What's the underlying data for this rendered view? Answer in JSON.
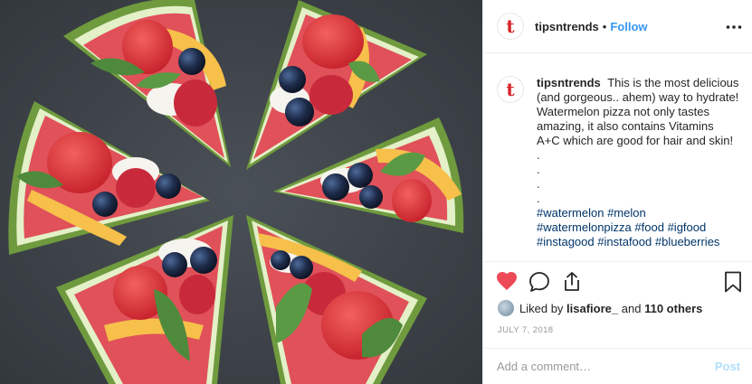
{
  "post": {
    "avatar_letter": "t",
    "username": "tipsntrends",
    "separator": "•",
    "follow_label": "Follow",
    "more_label": "•••"
  },
  "caption": {
    "username": "tipsntrends",
    "text": "This is the most delicious (and gorgeous.. ahem) way to hydrate! Watermelon pizza not only tastes amazing, it also contains Vitamins A+C which are good for hair and skin!",
    "dots": [
      ".",
      ".",
      ".",
      "."
    ],
    "hashtags": [
      [
        "#watermelon",
        "#melon"
      ],
      [
        "#watermelonpizza",
        "#food",
        "#igfood"
      ],
      [
        "#instagood",
        "#instafood",
        "#blueberries"
      ]
    ]
  },
  "actions": {
    "liked_prefix": "Liked by",
    "liked_user": "lisafiore_",
    "liked_and": "and",
    "liked_others": "110 others",
    "date": "JULY 7, 2018"
  },
  "comment": {
    "placeholder": "Add a comment…",
    "post_label": "Post"
  },
  "colors": {
    "like_red": "#ed4956",
    "link_blue": "#3897f0",
    "hashtag_navy": "#003569",
    "post_disabled": "#b2dffc",
    "avatar_red": "#d6262a"
  },
  "icons": [
    "heart-icon",
    "comment-icon",
    "share-icon",
    "bookmark-icon",
    "more-icon"
  ]
}
